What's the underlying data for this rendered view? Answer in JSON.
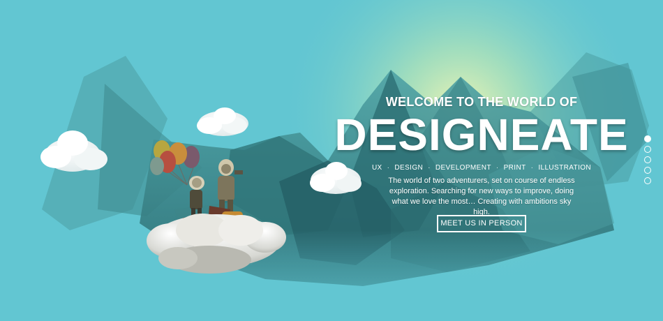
{
  "hero": {
    "kicker": "WELCOME TO THE WORLD OF",
    "brand": "DESIGNEATE",
    "services": [
      "UX",
      "DESIGN",
      "DEVELOPMENT",
      "PRINT",
      "ILLUSTRATION"
    ],
    "description": "The world of two adventurers, set on course of endless exploration. Searching for new ways to improve, doing what we love the most… Creating with ambitions sky high.",
    "cta_label": "MEET US IN PERSON"
  },
  "slider": {
    "total_slides": 5,
    "active_index": 0
  },
  "colors": {
    "sky": "#62c6d2",
    "mountain_dark": "#2b6e72",
    "mountain_mid": "#3f8f92",
    "glow": "#f4f6b0",
    "text": "#ffffff"
  }
}
